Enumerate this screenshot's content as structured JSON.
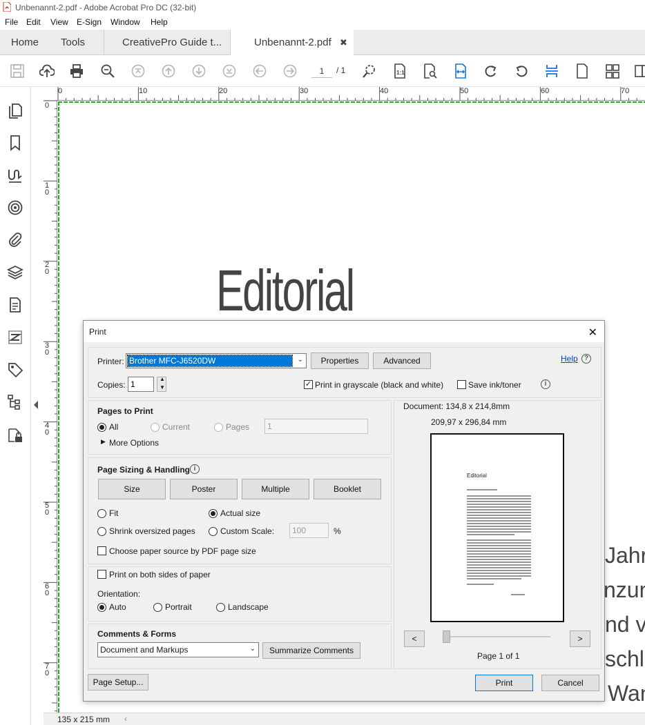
{
  "window": {
    "title": "Unbenannt-2.pdf - Adobe Acrobat Pro DC (32-bit)"
  },
  "menu": [
    "File",
    "Edit",
    "View",
    "E-Sign",
    "Window",
    "Help"
  ],
  "tabs": {
    "home": "Home",
    "tools": "Tools",
    "doc1": "CreativePro Guide t...",
    "doc2": "Unbenannt-2.pdf",
    "close": "✖"
  },
  "toolbar": {
    "current_page": "1",
    "page_total": "/ 1"
  },
  "ruler": {
    "h_labels": [
      "0",
      "10",
      "20",
      "30",
      "40",
      "50",
      "60",
      "70"
    ],
    "v_labels": [
      "0",
      "10",
      "20",
      "30",
      "40",
      "50",
      "60",
      "70"
    ]
  },
  "document": {
    "heading": "Editorial",
    "bg_lines": [
      "Jahre",
      "nzunt",
      "nd vo",
      "schlir",
      "Wan"
    ]
  },
  "status": {
    "page_size": "135 x 215 mm"
  },
  "dialog": {
    "title": "Print",
    "close": "✕",
    "printer_label": "Printer:",
    "printer_value": "Brother MFC-J6520DW",
    "properties": "Properties",
    "advanced": "Advanced",
    "help": "Help",
    "copies_label": "Copies:",
    "copies_value": "1",
    "grayscale": "Print in grayscale (black and white)",
    "grayscale_checked": true,
    "save_ink": "Save ink/toner",
    "save_ink_checked": false,
    "pages_to_print": {
      "heading": "Pages to Print",
      "all": "All",
      "current": "Current",
      "pages": "Pages",
      "pages_value": "1",
      "more_options": "More Options",
      "selected": "All"
    },
    "sizing": {
      "heading": "Page Sizing & Handling",
      "size": "Size",
      "poster": "Poster",
      "multiple": "Multiple",
      "booklet": "Booklet",
      "fit": "Fit",
      "actual_size": "Actual size",
      "shrink": "Shrink oversized pages",
      "custom_scale": "Custom Scale:",
      "custom_value": "100",
      "percent": "%",
      "paper_source": "Choose paper source by PDF page size",
      "selected": "Actual size"
    },
    "both_sides": "Print on both sides of paper",
    "orientation": {
      "heading": "Orientation:",
      "auto": "Auto",
      "portrait": "Portrait",
      "landscape": "Landscape",
      "selected": "Auto"
    },
    "comments": {
      "heading": "Comments & Forms",
      "value": "Document and Markups",
      "summarize": "Summarize Comments"
    },
    "preview": {
      "document_size": "Document: 134,8 x 214,8mm",
      "paper_size": "209,97 x 296,84 mm",
      "page_heading": "Editorial",
      "prev": "<",
      "next": ">",
      "page_of": "Page 1 of 1"
    },
    "page_setup": "Page Setup...",
    "print": "Print",
    "cancel": "Cancel"
  }
}
